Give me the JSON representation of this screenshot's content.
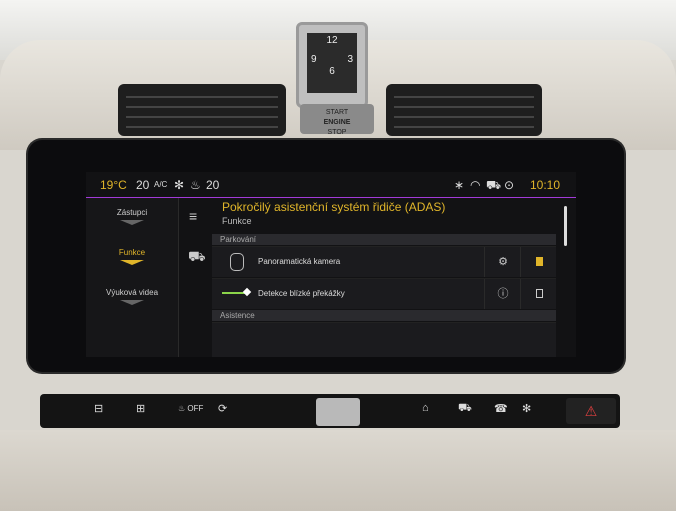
{
  "status": {
    "temp_left": "19°C",
    "fan_left": "20",
    "ac": "A/C",
    "fan_right": "20",
    "time": "10:10"
  },
  "sidebar": {
    "items": [
      {
        "label": "Zástupci"
      },
      {
        "label": "Funkce"
      },
      {
        "label": "Výuková videa"
      }
    ]
  },
  "main": {
    "title": "Pokročilý asistenční systém řidiče (ADAS)",
    "subtitle": "Funkce",
    "sections": [
      "Parkování",
      "Asistence"
    ],
    "rows": [
      {
        "label": "Panoramatická kamera"
      },
      {
        "label": "Detekce blízké překážky"
      }
    ]
  },
  "clock": {
    "n12": "12",
    "n3": "3",
    "n6": "6",
    "n9": "9"
  },
  "engine": {
    "line1": "START",
    "line2": "ENGINE",
    "line3": "STOP"
  },
  "controls": {
    "off": "OFF"
  },
  "colors": {
    "accent": "#e0b52a",
    "green": "#8bd44a",
    "hazard": "#e04040"
  }
}
